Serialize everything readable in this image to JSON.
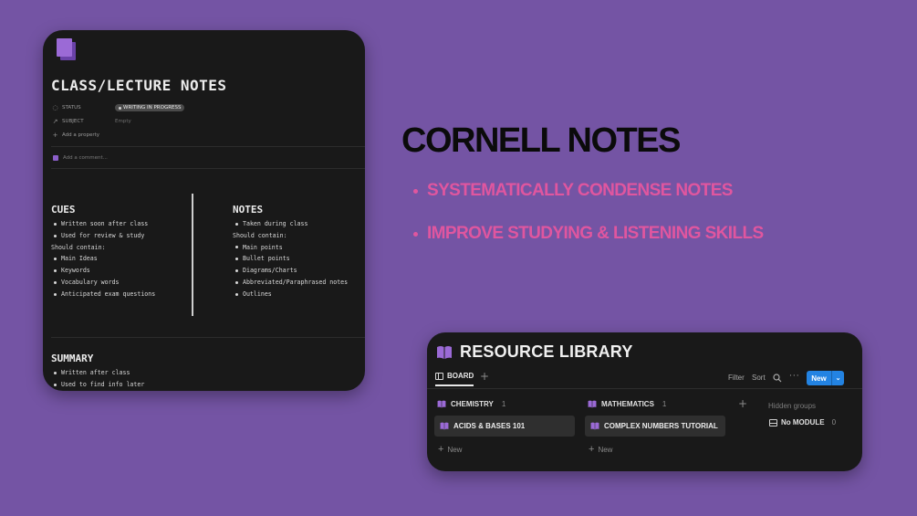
{
  "colors": {
    "background": "#7454a4",
    "window": "#191919",
    "headline": "#0b0b0b",
    "accent_pink": "#e0569f",
    "accent_purple": "#8b5fc9",
    "new_button": "#2383e2"
  },
  "notes_page": {
    "icon": "page-stack-icon",
    "title": "CLASS/LECTURE NOTES",
    "properties": [
      {
        "icon": "status-icon",
        "label": "STATUS",
        "value": "WRITING IN PROGRESS"
      },
      {
        "icon": "arrow-up-right-icon",
        "label": "SUBJECT",
        "value": "Empty"
      }
    ],
    "add_property": "Add a property",
    "add_comment": "Add a comment...",
    "cues": {
      "heading": "CUES",
      "items": [
        "Written soon after class",
        "Used for review & study",
        "Should contain:",
        "Main Ideas",
        "Keywords",
        "Vocabulary words",
        "Anticipated exam questions"
      ]
    },
    "notes": {
      "heading": "NOTES",
      "items": [
        "Taken during class",
        "Should contain:",
        "Main points",
        "Bullet points",
        "Diagrams/Charts",
        "Abbreviated/Paraphrased notes",
        "Outlines"
      ]
    },
    "summary": {
      "heading": "SUMMARY",
      "items": [
        "Written after class",
        "Used to find info later"
      ]
    }
  },
  "headline": {
    "title": "CORNELL NOTES",
    "bullets": [
      "SYSTEMATICALLY CONDENSE NOTES",
      "IMPROVE STUDYING & LISTENING SKILLS"
    ]
  },
  "library": {
    "icon": "book-icon",
    "title": "RESOURCE LIBRARY",
    "tab": "BOARD",
    "toolbar": {
      "filter": "Filter",
      "sort": "Sort",
      "new": "New"
    },
    "groups": [
      {
        "name": "CHEMISTRY",
        "count": "1",
        "card": "ACIDS & BASES 101",
        "new": "New"
      },
      {
        "name": "MATHEMATICS",
        "count": "1",
        "card": "COMPLEX NUMBERS TUTORIAL",
        "new": "New"
      }
    ],
    "hidden_groups": "Hidden groups",
    "no_module": {
      "label": "No MODULE",
      "count": "0"
    }
  }
}
